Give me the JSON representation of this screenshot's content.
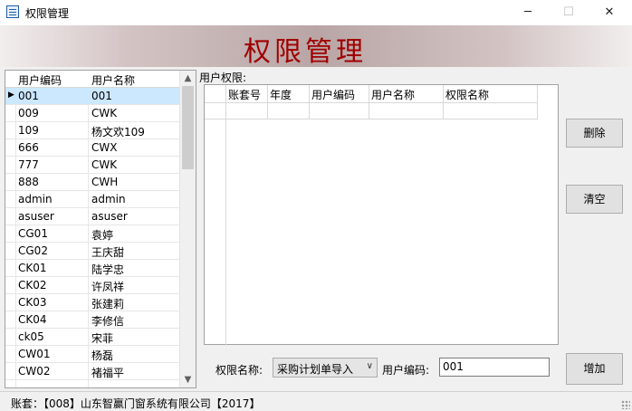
{
  "window": {
    "title": "权限管理",
    "minimize_glyph": "─",
    "maximize_glyph": "☐",
    "close_glyph": "✕"
  },
  "banner": {
    "title": "权限管理"
  },
  "users_grid": {
    "columns": [
      "用户编码",
      "用户名称"
    ],
    "selected_row": 0,
    "rows": [
      [
        "001",
        "001"
      ],
      [
        "009",
        "CWK"
      ],
      [
        "109",
        "杨文欢109"
      ],
      [
        "666",
        "CWX"
      ],
      [
        "777",
        "CWK"
      ],
      [
        "888",
        "CWH"
      ],
      [
        "admin",
        "admin"
      ],
      [
        "asuser",
        "asuser"
      ],
      [
        "CG01",
        "袁婷"
      ],
      [
        "CG02",
        "王庆甜"
      ],
      [
        "CK01",
        "陆学忠"
      ],
      [
        "CK02",
        "许凤祥"
      ],
      [
        "CK03",
        "张建莉"
      ],
      [
        "CK04",
        "李修信"
      ],
      [
        "ck05",
        "宋菲"
      ],
      [
        "CW01",
        "杨磊"
      ],
      [
        "CW02",
        "褚福平"
      ]
    ]
  },
  "permissions": {
    "label": "用户权限:",
    "columns": [
      "账套号",
      "年度",
      "用户编码",
      "用户名称",
      "权限名称"
    ]
  },
  "buttons": {
    "delete": "删除",
    "clear": "清空",
    "add": "增加"
  },
  "form": {
    "perm_name_label": "权限名称:",
    "perm_name_value": "采购计划单导入",
    "user_code_label": "用户编码:",
    "user_code_value": "001"
  },
  "status": {
    "text": "账套：【008】山东智赢门窗系统有限公司【2017】"
  },
  "colors": {
    "banner_text": "#a00000",
    "selection": "#cce8ff"
  }
}
